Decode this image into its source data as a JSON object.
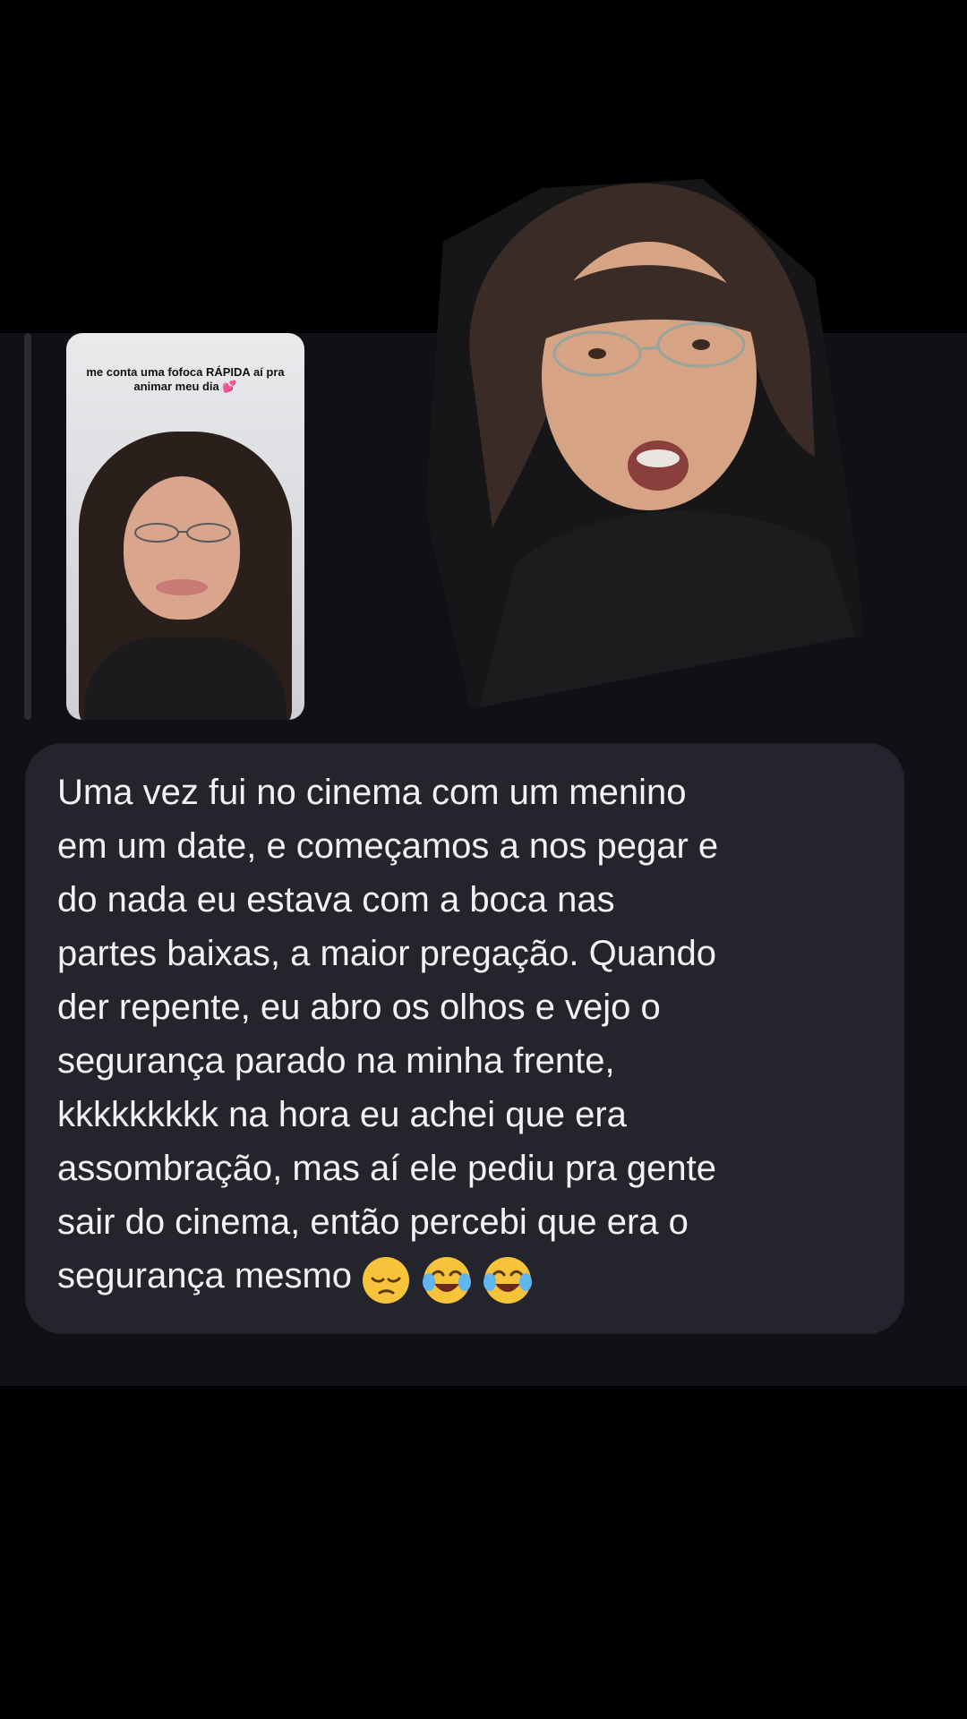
{
  "story": {
    "caption": "me conta uma fofoca RÁPIDA aí pra animar meu dia 💕"
  },
  "message": {
    "text": "Uma vez fui no cinema com um menino\nem um date, e começamos a nos pegar e\ndo nada eu estava com a boca nas\npartes baixas, a maior pregação. Quando\nder repente, eu abro os olhos e vejo o\nsegurança parado na minha frente,\nkkkkkkkkk na hora eu achei que era\nassombração, mas aí ele pediu pra gente\nsair do cinema, então percebi que era o\nsegurança mesmo",
    "emojis": [
      "pensive-face",
      "face-with-tears-of-joy",
      "face-with-tears-of-joy"
    ]
  },
  "colors": {
    "background": "#000000",
    "conversation": "#101116",
    "bubble": "#24252c",
    "text": "#f2f2f4"
  }
}
